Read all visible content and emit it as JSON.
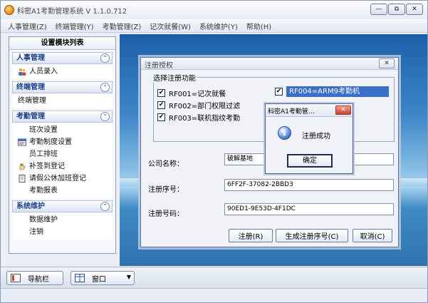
{
  "app": {
    "title": "科密A1考勤管理系统 V 1.1.0.712",
    "window_buttons": {
      "minimize": "—",
      "restore": "⧉",
      "close": "✕"
    }
  },
  "menubar": [
    "人事管理(Z)",
    "终端管理(Y)",
    "考勤管理(Z)",
    "记次就餐(W)",
    "系统维护(Y)",
    "帮助(H)"
  ],
  "sidebar": {
    "title": "设置模块列表",
    "groups": [
      {
        "label": "人事管理",
        "items": [
          {
            "label": "人员录入",
            "icon": "people-icon"
          }
        ]
      },
      {
        "label": "终端管理",
        "items": [
          {
            "label": "终端管理",
            "icon": ""
          }
        ]
      },
      {
        "label": "考勤管理",
        "items": [
          {
            "label": "班次设置",
            "icon": ""
          },
          {
            "label": "考勤制度设置",
            "icon": "schedule-icon"
          },
          {
            "label": "员工排班",
            "icon": ""
          },
          {
            "label": "补签到登记",
            "icon": "hand-icon"
          },
          {
            "label": "请假公休加班登记",
            "icon": "document-icon"
          },
          {
            "label": "考勤报表",
            "icon": ""
          }
        ]
      },
      {
        "label": "系统维护",
        "items": [
          {
            "label": "数据维护",
            "icon": ""
          },
          {
            "label": "注销",
            "icon": ""
          }
        ]
      }
    ]
  },
  "bottombar": {
    "nav_button": "导航栏",
    "window_button": "窗口"
  },
  "register_dialog": {
    "title": "注册授权",
    "close": "✕",
    "group_label": "选择注册功能",
    "features": [
      {
        "label": "RF001=记次就餐",
        "checked": true
      },
      {
        "label": "RF004=ARM9考勤机",
        "checked": true
      },
      {
        "label": "RF002=部门权限过滤",
        "checked": true
      },
      {
        "label": "RF003=联机指纹考勤",
        "checked": true
      }
    ],
    "company_label": "公司名称：",
    "company_value": "破解基地",
    "serial_label": "注册序号：",
    "serial_value": "6FF2F-37082-2BBD3",
    "regcode_label": "注册号码：",
    "regcode_value": "90ED1-9E53D-4F1DC",
    "buttons": {
      "register": "注册(R)",
      "generate": "生成注册序号(C)",
      "cancel": "取消(C)"
    }
  },
  "message_box": {
    "title": "科密A1考勤管...",
    "close": "✕",
    "icon": "info-icon",
    "text": "注册成功",
    "ok": "确定"
  },
  "colors": {
    "accent": "#3a6fc7",
    "group_header_text": "#1a3e8c",
    "desktop_sky": "#3d86c8"
  }
}
